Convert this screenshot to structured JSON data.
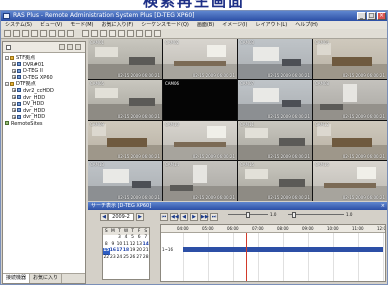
{
  "banner": {
    "text": "検索再生画面"
  },
  "window": {
    "title": "RAS Plus - Remote Administration System Plus  [D-TEG XP60]",
    "buttons": [
      "_",
      "□",
      "×"
    ]
  },
  "menu": [
    "システム(S)",
    "ビュー(V)",
    "モード(M)",
    "お気に入り(F)",
    "シーケンスモード(Q)",
    "画面(B)",
    "イメージ(I)",
    "レイアウト(L)",
    "ヘルプ(H)"
  ],
  "left_panel": {
    "tree": [
      {
        "label": "STF拠点",
        "depth": 0,
        "kind": "grp",
        "toggle": "-"
      },
      {
        "label": "DVR#01",
        "depth": 1,
        "kind": "dev",
        "toggle": "+"
      },
      {
        "label": "D-TEG II",
        "depth": 1,
        "kind": "dev",
        "toggle": "+"
      },
      {
        "label": "D-TEG XP60",
        "depth": 1,
        "kind": "dev",
        "toggle": "+"
      },
      {
        "label": "DTF拠点",
        "depth": 0,
        "kind": "grp",
        "toggle": "-"
      },
      {
        "label": "dvr2_ccHDD",
        "depth": 1,
        "kind": "dev",
        "toggle": "+"
      },
      {
        "label": "dvr_HDD",
        "depth": 1,
        "kind": "dev",
        "toggle": "+"
      },
      {
        "label": "DV_HDD",
        "depth": 1,
        "kind": "dev",
        "toggle": "+"
      },
      {
        "label": "dvr_HDD",
        "depth": 1,
        "kind": "dev",
        "toggle": "+"
      },
      {
        "label": "dvr_HDD",
        "depth": 1,
        "kind": "dev",
        "toggle": "+"
      },
      {
        "label": "RemoteSites",
        "depth": 0,
        "kind": "site",
        "toggle": ""
      }
    ],
    "tabs": [
      "接続機器",
      "お気に入り"
    ]
  },
  "cameras": [
    {
      "label": "CAM01",
      "time": "02-15 2009 06:00:21",
      "scene": "office"
    },
    {
      "label": "CAM02",
      "time": "02-15 2009 06:00:21",
      "scene": "lobby"
    },
    {
      "label": "CAM03",
      "time": "02-15 2009 06:00:21",
      "scene": "room"
    },
    {
      "label": "CAM04",
      "time": "02-15 2009 06:00:21",
      "scene": "table"
    },
    {
      "label": "CAM05",
      "time": "02-15 2009 06:00:21",
      "scene": "office"
    },
    {
      "label": "CAM06",
      "time": "",
      "scene": "black"
    },
    {
      "label": "CAM07",
      "time": "02-15 2009 06:00:21",
      "scene": "room"
    },
    {
      "label": "CAM08",
      "time": "02-15 2009 06:00:21",
      "scene": "hall"
    },
    {
      "label": "CAM09",
      "time": "02-15 2009 06:00:21",
      "scene": "table"
    },
    {
      "label": "CAM10",
      "time": "02-15 2009 06:00:21",
      "scene": "lobby"
    },
    {
      "label": "CAM11",
      "time": "02-15 2009 06:00:21",
      "scene": "office"
    },
    {
      "label": "CAM12",
      "time": "02-15 2009 06:00:21",
      "scene": "table"
    },
    {
      "label": "CAM13",
      "time": "02-15 2009 06:00:21",
      "scene": "room"
    },
    {
      "label": "CAM14",
      "time": "02-15 2009 06:00:21",
      "scene": "hall"
    },
    {
      "label": "CAM15",
      "time": "02-15 2009 06:00:21",
      "scene": "office"
    },
    {
      "label": "CAM16",
      "time": "02-15 2009 06:00:21",
      "scene": "lobby"
    }
  ],
  "search": {
    "title": "サーチ表示 [D-TEG XP60]",
    "year_month": "2009-2",
    "nav": [
      "◀",
      "▶",
      "⏮",
      "◀◀",
      "◀",
      "▶",
      "▶▶",
      "⏭"
    ],
    "speed_value": "1.0",
    "volume_value": "1.0",
    "calendar": {
      "weekdays": [
        "S",
        "M",
        "T",
        "W",
        "T",
        "F",
        "S"
      ],
      "days": [
        "",
        "",
        "",
        "",
        "",
        "",
        "",
        "",
        "",
        "",
        "",
        "",
        "",
        "",
        "",
        "",
        "3",
        "4",
        "5",
        "6",
        "7",
        "8",
        "9",
        "10",
        "11",
        "12",
        "13",
        "14",
        "15",
        "16",
        "17",
        "18",
        "19",
        "20",
        "21",
        "22",
        "23",
        "24",
        "25",
        "26",
        "27",
        "28"
      ],
      "recorded_days": [
        "14",
        "15",
        "16",
        "17",
        "18"
      ],
      "selected_day": "15"
    },
    "timeline": {
      "hours": [
        "04:00",
        "05:00",
        "06:00",
        "07:00",
        "08:00",
        "09:00",
        "10:00",
        "11:00",
        "12:00"
      ],
      "camera_label": "1~16",
      "record_from_hour": 4,
      "record_to_hour": 12,
      "cursor_hour": 6.5
    }
  }
}
